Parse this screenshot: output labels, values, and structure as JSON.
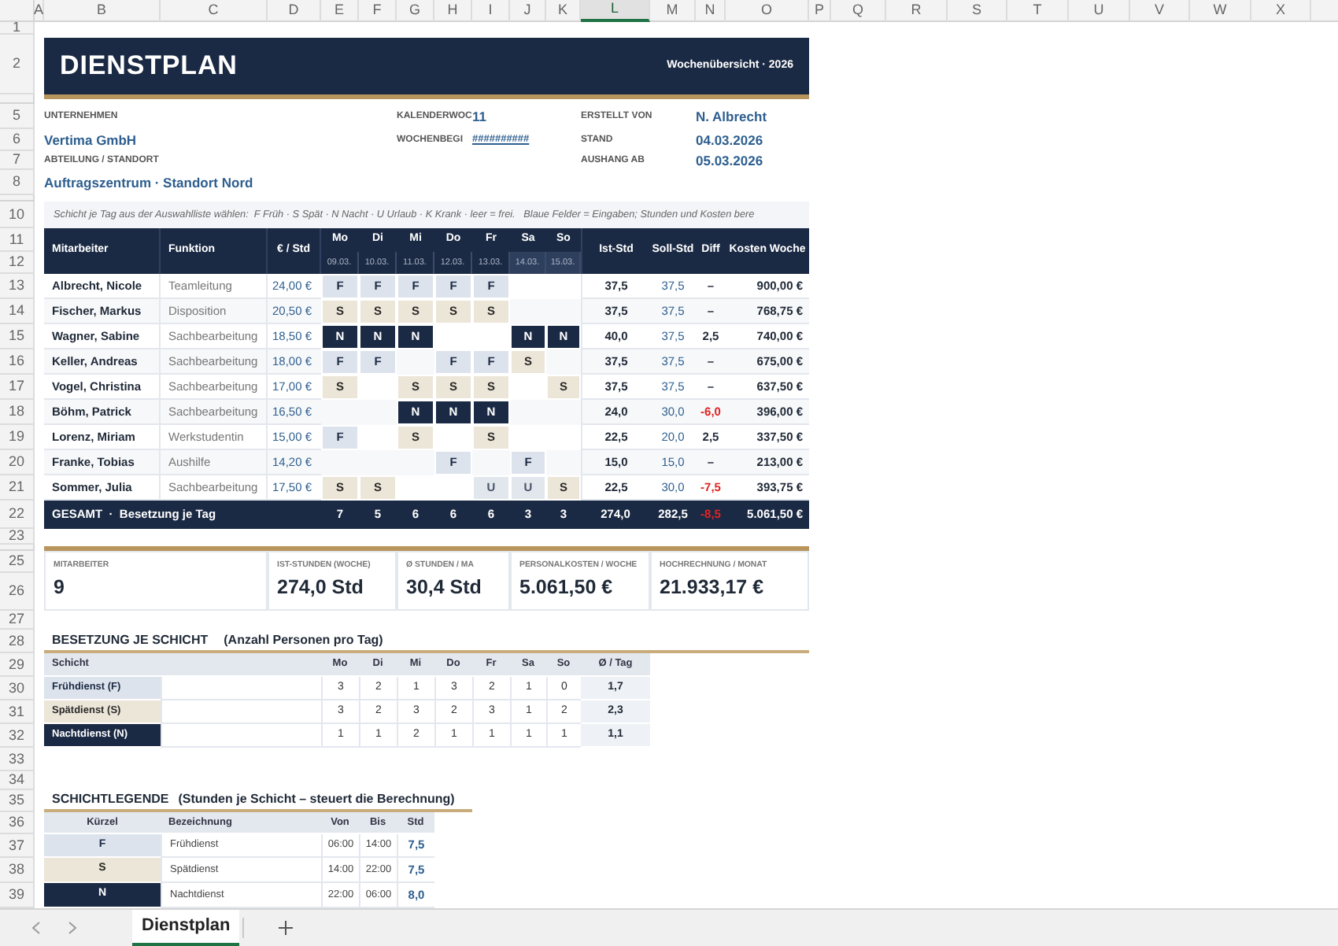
{
  "column_headers": [
    {
      "label": "A",
      "selected": false
    },
    {
      "label": "B",
      "selected": false
    },
    {
      "label": "C",
      "selected": false
    },
    {
      "label": "D",
      "selected": false
    },
    {
      "label": "E",
      "selected": false
    },
    {
      "label": "F",
      "selected": false
    },
    {
      "label": "G",
      "selected": false
    },
    {
      "label": "H",
      "selected": false
    },
    {
      "label": "I",
      "selected": false
    },
    {
      "label": "J",
      "selected": false
    },
    {
      "label": "K",
      "selected": false
    },
    {
      "label": "L",
      "selected": true
    },
    {
      "label": "M",
      "selected": false
    },
    {
      "label": "N",
      "selected": false
    },
    {
      "label": "O",
      "selected": false
    },
    {
      "label": "P",
      "selected": false
    },
    {
      "label": "Q",
      "selected": false
    },
    {
      "label": "R",
      "selected": false
    },
    {
      "label": "S",
      "selected": false
    },
    {
      "label": "T",
      "selected": false
    },
    {
      "label": "U",
      "selected": false
    },
    {
      "label": "V",
      "selected": false
    },
    {
      "label": "W",
      "selected": false
    },
    {
      "label": "X",
      "selected": false
    }
  ],
  "row_numbers": [
    "1",
    "2",
    "5",
    "6",
    "7",
    "8",
    "10",
    "11",
    "12",
    "13",
    "14",
    "15",
    "16",
    "17",
    "18",
    "19",
    "20",
    "21",
    "22",
    "23",
    "25",
    "26",
    "27",
    "28",
    "29",
    "30",
    "31",
    "32",
    "33",
    "34",
    "35",
    "36",
    "37",
    "38",
    "39"
  ],
  "header": {
    "title": "DIENSTPLAN",
    "subtitle": "Wochenübersicht · 2026"
  },
  "info": {
    "company_label": "UNTERNEHMEN",
    "company": "Vertima GmbH",
    "department_label": "ABTEILUNG / STANDORT",
    "department": "Auftragszentrum · Standort Nord",
    "week_label": "KALENDERWOC",
    "week": "11",
    "week_start_label": "WOCHENBEGI",
    "week_start": "##########",
    "author_label": "ERSTELLT VON",
    "author": "N. Albrecht",
    "status_label": "STAND",
    "status_date": "04.03.2026",
    "posting_label": "AUSHANG AB",
    "posting_date": "05.03.2026"
  },
  "instructions": "Schicht je Tag aus der Auswahlliste wählen:  F Früh · S Spät · N Nacht · U Urlaub · K Krank · leer = frei.   Blaue Felder = Eingaben; Stunden und Kosten bere",
  "schedule": {
    "columns": {
      "name": "Mitarbeiter",
      "function": "Funktion",
      "rate": "€ / Std",
      "ist": "Ist-Std",
      "soll": "Soll-Std",
      "diff": "Diff",
      "cost": "Kosten Woche"
    },
    "days": [
      {
        "day": "Mo",
        "date": "09.03.",
        "weekend": false
      },
      {
        "day": "Di",
        "date": "10.03.",
        "weekend": false
      },
      {
        "day": "Mi",
        "date": "11.03.",
        "weekend": false
      },
      {
        "day": "Do",
        "date": "12.03.",
        "weekend": false
      },
      {
        "day": "Fr",
        "date": "13.03.",
        "weekend": false
      },
      {
        "day": "Sa",
        "date": "14.03.",
        "weekend": true
      },
      {
        "day": "So",
        "date": "15.03.",
        "weekend": true
      }
    ],
    "rows": [
      {
        "name": "Albrecht, Nicole",
        "function": "Teamleitung",
        "rate": "24,00 €",
        "shifts": [
          {
            "kind": "early",
            "code": "F"
          },
          {
            "kind": "early",
            "code": "F"
          },
          {
            "kind": "early",
            "code": "F"
          },
          {
            "kind": "early",
            "code": "F"
          },
          {
            "kind": "early",
            "code": "F"
          },
          {
            "kind": "free"
          },
          {
            "kind": "free"
          }
        ],
        "ist": "37,5",
        "soll": "37,5",
        "diff": "–",
        "negative": false,
        "cost": "900,00 €"
      },
      {
        "name": "Fischer, Markus",
        "function": "Disposition",
        "rate": "20,50 €",
        "shifts": [
          {
            "kind": "late",
            "code": "S"
          },
          {
            "kind": "late",
            "code": "S"
          },
          {
            "kind": "late",
            "code": "S"
          },
          {
            "kind": "late",
            "code": "S"
          },
          {
            "kind": "late",
            "code": "S"
          },
          {
            "kind": "free"
          },
          {
            "kind": "free"
          }
        ],
        "ist": "37,5",
        "soll": "37,5",
        "diff": "–",
        "negative": false,
        "cost": "768,75 €"
      },
      {
        "name": "Wagner, Sabine",
        "function": "Sachbearbeitung",
        "rate": "18,50 €",
        "shifts": [
          {
            "kind": "night",
            "code": "N"
          },
          {
            "kind": "night",
            "code": "N"
          },
          {
            "kind": "night",
            "code": "N"
          },
          {
            "kind": "free"
          },
          {
            "kind": "free"
          },
          {
            "kind": "night",
            "code": "N"
          },
          {
            "kind": "night",
            "code": "N"
          }
        ],
        "ist": "40,0",
        "soll": "37,5",
        "diff": "2,5",
        "negative": false,
        "cost": "740,00 €"
      },
      {
        "name": "Keller, Andreas",
        "function": "Sachbearbeitung",
        "rate": "18,00 €",
        "shifts": [
          {
            "kind": "early",
            "code": "F"
          },
          {
            "kind": "early",
            "code": "F"
          },
          {
            "kind": "free"
          },
          {
            "kind": "early",
            "code": "F"
          },
          {
            "kind": "early",
            "code": "F"
          },
          {
            "kind": "late",
            "code": "S"
          },
          {
            "kind": "free"
          }
        ],
        "ist": "37,5",
        "soll": "37,5",
        "diff": "–",
        "negative": false,
        "cost": "675,00 €"
      },
      {
        "name": "Vogel, Christina",
        "function": "Sachbearbeitung",
        "rate": "17,00 €",
        "shifts": [
          {
            "kind": "late",
            "code": "S"
          },
          {
            "kind": "free"
          },
          {
            "kind": "late",
            "code": "S"
          },
          {
            "kind": "late",
            "code": "S"
          },
          {
            "kind": "late",
            "code": "S"
          },
          {
            "kind": "free"
          },
          {
            "kind": "late",
            "code": "S"
          }
        ],
        "ist": "37,5",
        "soll": "37,5",
        "diff": "–",
        "negative": false,
        "cost": "637,50 €"
      },
      {
        "name": "Böhm, Patrick",
        "function": "Sachbearbeitung",
        "rate": "16,50 €",
        "shifts": [
          {
            "kind": "free"
          },
          {
            "kind": "free"
          },
          {
            "kind": "night",
            "code": "N"
          },
          {
            "kind": "night",
            "code": "N"
          },
          {
            "kind": "night",
            "code": "N"
          },
          {
            "kind": "free"
          },
          {
            "kind": "free"
          }
        ],
        "ist": "24,0",
        "soll": "30,0",
        "diff": "-6,0",
        "negative": true,
        "cost": "396,00 €"
      },
      {
        "name": "Lorenz, Miriam",
        "function": "Werkstudentin",
        "rate": "15,00 €",
        "shifts": [
          {
            "kind": "early",
            "code": "F"
          },
          {
            "kind": "free"
          },
          {
            "kind": "late",
            "code": "S"
          },
          {
            "kind": "free"
          },
          {
            "kind": "late",
            "code": "S"
          },
          {
            "kind": "free"
          },
          {
            "kind": "free"
          }
        ],
        "ist": "22,5",
        "soll": "20,0",
        "diff": "2,5",
        "negative": false,
        "cost": "337,50 €"
      },
      {
        "name": "Franke, Tobias",
        "function": "Aushilfe",
        "rate": "14,20 €",
        "shifts": [
          {
            "kind": "free"
          },
          {
            "kind": "free"
          },
          {
            "kind": "free"
          },
          {
            "kind": "early",
            "code": "F"
          },
          {
            "kind": "free"
          },
          {
            "kind": "early",
            "code": "F"
          },
          {
            "kind": "free"
          }
        ],
        "ist": "15,0",
        "soll": "15,0",
        "diff": "–",
        "negative": false,
        "cost": "213,00 €"
      },
      {
        "name": "Sommer, Julia",
        "function": "Sachbearbeitung",
        "rate": "17,50 €",
        "shifts": [
          {
            "kind": "late",
            "code": "S"
          },
          {
            "kind": "late",
            "code": "S"
          },
          {
            "kind": "free"
          },
          {
            "kind": "free"
          },
          {
            "kind": "vacation",
            "code": "U"
          },
          {
            "kind": "vacation",
            "code": "U"
          },
          {
            "kind": "late",
            "code": "S"
          }
        ],
        "ist": "22,5",
        "soll": "30,0",
        "diff": "-7,5",
        "negative": true,
        "cost": "393,75 €"
      }
    ],
    "total": {
      "label": "GESAMT  ·  Besetzung je Tag",
      "counts": [
        "7",
        "5",
        "6",
        "6",
        "6",
        "3",
        "3"
      ],
      "ist": "274,0",
      "soll": "282,5",
      "diff": "-8,5",
      "negative": true,
      "cost": "5.061,50 €"
    }
  },
  "kpis": [
    {
      "label": "MITARBEITER",
      "value": "9"
    },
    {
      "label": "IST-STUNDEN (WOCHE)",
      "value": "274,0 Std"
    },
    {
      "label": "Ø STUNDEN / MA",
      "value": "30,4 Std"
    },
    {
      "label": "PERSONALKOSTEN / WOCHE",
      "value": "5.061,50 €"
    },
    {
      "label": "HOCHRECHNUNG / MONAT",
      "value": "21.933,17 €"
    }
  ],
  "staffing": {
    "title": "BESETZUNG JE SCHICHT",
    "note": "(Anzahl Personen pro Tag)",
    "columns": [
      "Schicht",
      "Mo",
      "Di",
      "Mi",
      "Do",
      "Fr",
      "Sa",
      "So",
      "Ø / Tag"
    ],
    "rows": [
      {
        "name": "Frühdienst (F)",
        "kind": "early",
        "counts": [
          "3",
          "2",
          "1",
          "3",
          "2",
          "1",
          "0"
        ],
        "avg": "1,7"
      },
      {
        "name": "Spätdienst (S)",
        "kind": "late",
        "counts": [
          "3",
          "2",
          "3",
          "2",
          "3",
          "1",
          "2"
        ],
        "avg": "2,3"
      },
      {
        "name": "Nachtdienst (N)",
        "kind": "night",
        "counts": [
          "1",
          "1",
          "2",
          "1",
          "1",
          "1",
          "1"
        ],
        "avg": "1,1"
      }
    ]
  },
  "legend": {
    "title": "SCHICHTLEGENDE",
    "note": "(Stunden je Schicht – steuert die Berechnung)",
    "columns": [
      "Kürzel",
      "Bezeichnung",
      "Von",
      "Bis",
      "Std"
    ],
    "rows": [
      {
        "code": "F",
        "kind": "early",
        "name": "Frühdienst",
        "from": "06:00",
        "to": "14:00",
        "hours": "7,5"
      },
      {
        "code": "S",
        "kind": "late",
        "name": "Spätdienst",
        "from": "14:00",
        "to": "22:00",
        "hours": "7,5"
      },
      {
        "code": "N",
        "kind": "night",
        "name": "Nachtdienst",
        "from": "22:00",
        "to": "06:00",
        "hours": "8,0"
      }
    ]
  },
  "sheet_tabs": [
    {
      "label": "Dienstplan",
      "selected": true
    }
  ]
}
